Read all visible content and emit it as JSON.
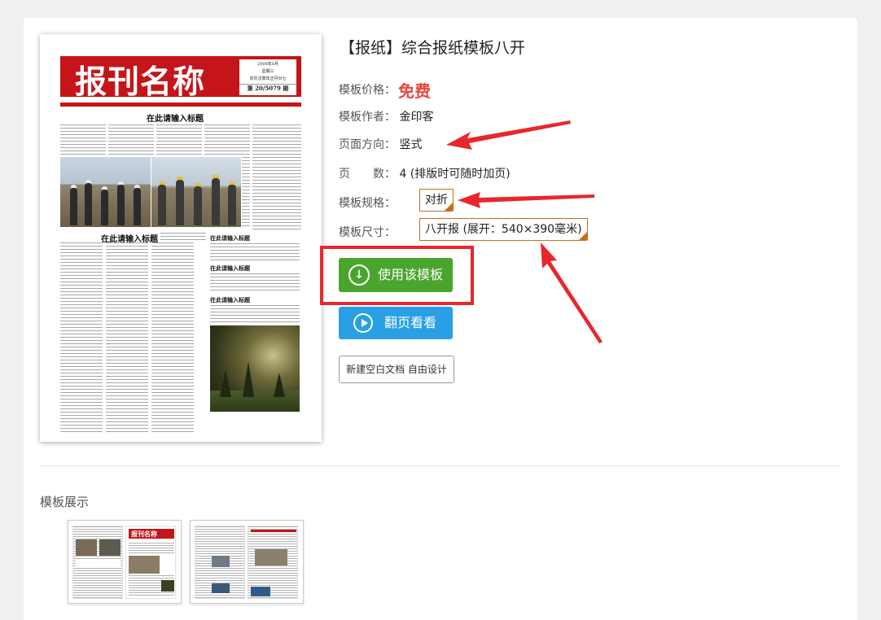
{
  "template": {
    "title": "【报纸】综合报纸模板八开",
    "price_label": "模板价格：",
    "price_value": "免费",
    "author_label": "模板作者：",
    "author_value": "金印客",
    "orientation_label": "页面方向：",
    "orientation_value": "竖式",
    "pages_label": "页　　数：",
    "pages_value": "4 (排版时可随时加页)",
    "spec_label": "模板规格：",
    "spec_value": "对折",
    "size_label": "模板尺寸：",
    "size_value": "八开报 (展开：540×390毫米)"
  },
  "buttons": {
    "use_template": "使用该模板",
    "flip_preview": "翻页看看",
    "new_blank": "新建空白文档 自由设计"
  },
  "preview": {
    "masthead": "报刊名称",
    "date_line": "2008年8月",
    "weekday": "星期三",
    "lunar": "农历戊寅年正月廿七",
    "issue": "第 20/5079 期",
    "headline_main": "在此请输入标题",
    "headline_second": "在此请输入标题",
    "side_headline_1": "在此请输入标题",
    "side_headline_2": "在此请输入标题",
    "side_headline_3": "在此请输入标题"
  },
  "gallery": {
    "title": "模板展示",
    "thumb_masthead": "报刊名称"
  },
  "colors": {
    "accent_red": "#c4151a",
    "price_red": "#e8463f",
    "use_button_green": "#4aa52e",
    "flip_button_blue": "#2aa0e4",
    "annotation_red": "#e8272c",
    "chip_orange": "#c86e1a"
  }
}
